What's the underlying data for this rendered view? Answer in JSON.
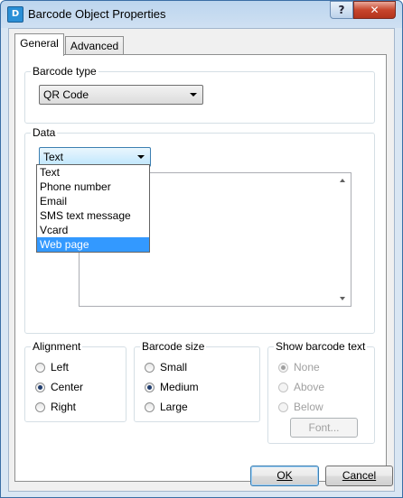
{
  "window": {
    "title": "Barcode Object Properties",
    "icon_glyph": "D",
    "help_glyph": "?",
    "close_glyph": "✕"
  },
  "tabs": [
    {
      "label": "General",
      "active": true
    },
    {
      "label": "Advanced",
      "active": false
    }
  ],
  "barcode_type": {
    "label": "Barcode type",
    "value": "QR Code"
  },
  "data": {
    "label": "Data",
    "selected": "Text",
    "options": [
      "Text",
      "Phone number",
      "Email",
      "SMS text message",
      "Vcard",
      "Web page"
    ],
    "highlighted": "Web page"
  },
  "alignment": {
    "label": "Alignment",
    "options": [
      "Left",
      "Center",
      "Right"
    ],
    "selected": "Center"
  },
  "barcode_size": {
    "label": "Barcode size",
    "options": [
      "Small",
      "Medium",
      "Large"
    ],
    "selected": "Medium"
  },
  "show_text": {
    "label": "Show barcode text",
    "options": [
      "None",
      "Above",
      "Below"
    ],
    "selected": "None",
    "font_button": "Font...",
    "enabled": false
  },
  "buttons": {
    "ok": "OK",
    "cancel": "Cancel"
  },
  "colors": {
    "selection": "#3399ff",
    "title_gradient_top": "#bcd5ee",
    "close_button": "#c7452c"
  }
}
